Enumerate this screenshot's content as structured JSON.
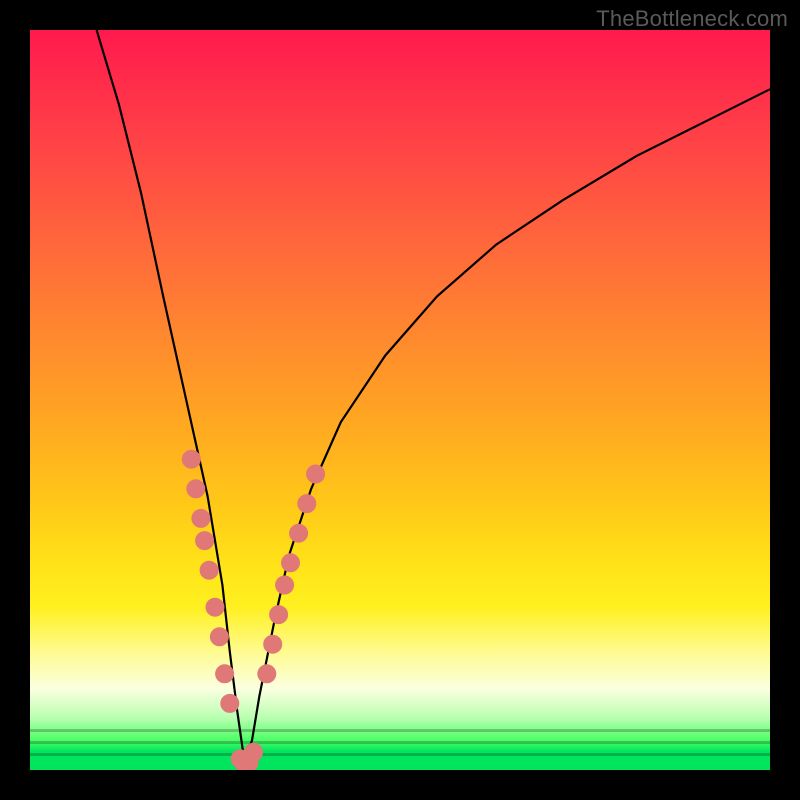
{
  "watermark": "TheBottleneck.com",
  "colors": {
    "frame": "#000000",
    "curve": "#000000",
    "dot_fill": "#e07878",
    "gradient_top": "#ff1a4d",
    "gradient_bottom": "#00e45e"
  },
  "chart_data": {
    "type": "line",
    "title": "",
    "xlabel": "",
    "ylabel": "",
    "xlim": [
      0,
      100
    ],
    "ylim": [
      0,
      100
    ],
    "notes": "V-shaped curve over a red→yellow→green vertical gradient. Apex near x≈29 at y≈0. Salmon dots cluster along both arms of the V in the lower (green/yellow) region, plus a few at the apex.",
    "series": [
      {
        "name": "v-curve",
        "x": [
          9,
          12,
          15,
          18,
          20,
          22,
          24,
          26,
          27,
          28,
          29,
          30,
          31,
          33,
          35,
          38,
          42,
          48,
          55,
          63,
          72,
          82,
          92,
          100
        ],
        "y": [
          100,
          90,
          78,
          64,
          55,
          46,
          37,
          25,
          16,
          8,
          1,
          4,
          10,
          20,
          29,
          38,
          47,
          56,
          64,
          71,
          77,
          83,
          88,
          92
        ]
      },
      {
        "name": "dots-left-arm",
        "x": [
          21.8,
          22.4,
          23.1,
          23.6,
          24.2,
          25.0,
          25.6,
          26.3,
          27.0
        ],
        "y": [
          42,
          38,
          34,
          31,
          27,
          22,
          18,
          13,
          9
        ]
      },
      {
        "name": "dots-right-arm",
        "x": [
          32.0,
          32.8,
          33.6,
          34.4,
          35.2,
          36.3,
          37.4,
          38.6
        ],
        "y": [
          13,
          17,
          21,
          25,
          28,
          32,
          36,
          40
        ]
      },
      {
        "name": "dots-apex",
        "x": [
          28.4,
          29.0,
          29.6,
          30.2
        ],
        "y": [
          1.5,
          0.8,
          1.0,
          2.4
        ]
      }
    ]
  }
}
